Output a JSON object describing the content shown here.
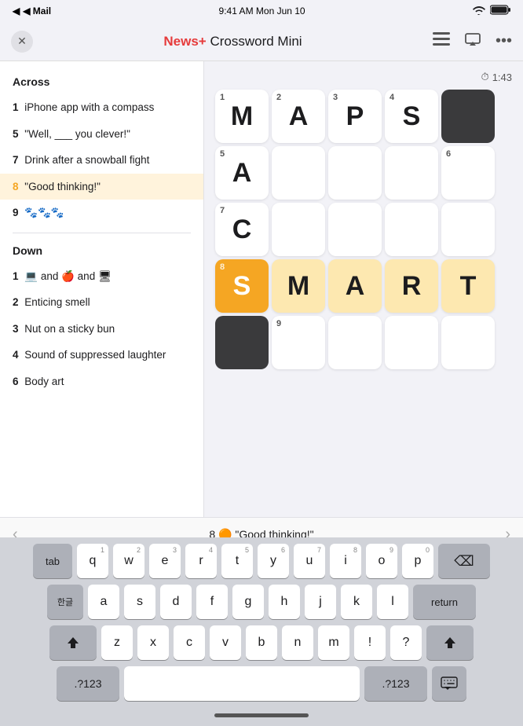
{
  "statusBar": {
    "left": "◀ Mail",
    "center": "9:41 AM  Mon Jun 10",
    "wifi": "WiFi",
    "battery": "100%"
  },
  "navBar": {
    "title": "News+ Crossword Mini",
    "closeLabel": "✕",
    "icons": [
      "list",
      "airplay",
      "more"
    ]
  },
  "timer": "1:43",
  "clues": {
    "across": {
      "title": "Across",
      "items": [
        {
          "num": "1",
          "text": "iPhone app with a compass"
        },
        {
          "num": "5",
          "text": "\"Well, ___ you clever!\""
        },
        {
          "num": "7",
          "text": "Drink after a snowball fight"
        },
        {
          "num": "8",
          "text": "\"Good thinking!\"",
          "active": true
        },
        {
          "num": "9",
          "text": "🐾🐾🐾"
        }
      ]
    },
    "down": {
      "title": "Down",
      "items": [
        {
          "num": "1",
          "text": "💻 and 🍎 and 🖥"
        },
        {
          "num": "2",
          "text": "Enticing smell"
        },
        {
          "num": "3",
          "text": "Nut on a sticky bun"
        },
        {
          "num": "4",
          "text": "Sound of suppressed laughter"
        },
        {
          "num": "6",
          "text": "Body art"
        }
      ]
    }
  },
  "grid": {
    "cells": [
      [
        {
          "num": "1",
          "letter": "M",
          "state": "normal"
        },
        {
          "num": "2",
          "letter": "A",
          "state": "normal"
        },
        {
          "num": "3",
          "letter": "P",
          "state": "normal"
        },
        {
          "num": "4",
          "letter": "S",
          "state": "normal"
        },
        {
          "letter": "",
          "state": "black"
        }
      ],
      [
        {
          "num": "5",
          "letter": "A",
          "state": "normal"
        },
        {
          "letter": "",
          "state": "empty"
        },
        {
          "letter": "",
          "state": "empty"
        },
        {
          "letter": "",
          "state": "empty"
        },
        {
          "num": "6",
          "letter": "",
          "state": "normal"
        }
      ],
      [
        {
          "num": "7",
          "letter": "C",
          "state": "normal"
        },
        {
          "letter": "",
          "state": "empty"
        },
        {
          "letter": "",
          "state": "empty"
        },
        {
          "letter": "",
          "state": "empty"
        },
        {
          "letter": "",
          "state": "empty"
        }
      ],
      [
        {
          "num": "8",
          "letter": "S",
          "state": "active"
        },
        {
          "letter": "M",
          "state": "highlighted"
        },
        {
          "letter": "A",
          "state": "highlighted"
        },
        {
          "letter": "R",
          "state": "highlighted"
        },
        {
          "letter": "T",
          "state": "highlighted"
        }
      ],
      [
        {
          "letter": "",
          "state": "black"
        },
        {
          "num": "9",
          "letter": "",
          "state": "normal"
        },
        {
          "letter": "",
          "state": "normal"
        },
        {
          "letter": "",
          "state": "normal"
        },
        {
          "letter": "",
          "state": "normal"
        }
      ]
    ]
  },
  "clueHint": {
    "text": "8 🟠 \"Good thinking!\""
  },
  "keyboard": {
    "rows": [
      [
        {
          "label": "tab",
          "special": true
        },
        {
          "label": "q",
          "num": "1"
        },
        {
          "label": "w",
          "num": "2"
        },
        {
          "label": "e",
          "num": "3"
        },
        {
          "label": "r",
          "num": "4"
        },
        {
          "label": "t",
          "num": "5"
        },
        {
          "label": "y",
          "num": "6"
        },
        {
          "label": "u",
          "num": "7"
        },
        {
          "label": "i",
          "num": "8"
        },
        {
          "label": "o",
          "num": "9"
        },
        {
          "label": "p",
          "num": "0"
        },
        {
          "label": "delete",
          "special": true,
          "wide": true
        }
      ],
      [
        {
          "label": "한글",
          "special": true
        },
        {
          "label": "a",
          "num": ""
        },
        {
          "label": "s",
          "num": ""
        },
        {
          "label": "d",
          "num": ""
        },
        {
          "label": "f",
          "num": ""
        },
        {
          "label": "g",
          "num": ""
        },
        {
          "label": "h",
          "num": ""
        },
        {
          "label": "j",
          "num": ""
        },
        {
          "label": "k",
          "num": ""
        },
        {
          "label": "l",
          "num": ""
        },
        {
          "label": "return",
          "special": true,
          "wide": true
        }
      ],
      [
        {
          "label": "shift",
          "special": true,
          "wide": true
        },
        {
          "label": "z",
          "num": ""
        },
        {
          "label": "x",
          "num": ""
        },
        {
          "label": "c",
          "num": ""
        },
        {
          "label": "v",
          "num": ""
        },
        {
          "label": "b",
          "num": ""
        },
        {
          "label": "n",
          "num": ""
        },
        {
          "label": "m",
          "num": ""
        },
        {
          "label": "!",
          "num": ""
        },
        {
          "label": "?",
          "num": ""
        },
        {
          "label": "shift",
          "special": true,
          "wide": true
        }
      ],
      [
        {
          "label": ".?123",
          "special": true,
          "wide": true
        },
        {
          "label": "space",
          "space": true
        },
        {
          "label": ".?123",
          "special": true,
          "wide": true
        },
        {
          "label": "⌨",
          "special": true
        }
      ]
    ]
  }
}
